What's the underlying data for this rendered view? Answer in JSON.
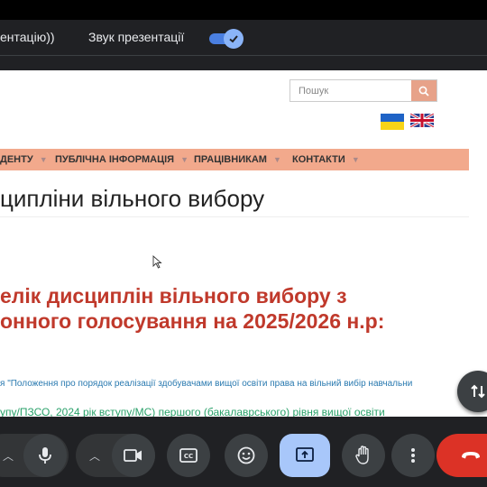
{
  "share_bar": {
    "tab_audio_text": "ентацію))",
    "sound_label": "Звук презентації",
    "sound_enabled": true
  },
  "website": {
    "search_placeholder": "Пошук",
    "languages": [
      "ua-flag-icon",
      "uk-flag-icon"
    ],
    "nav": [
      {
        "label": "ДЕНТУ"
      },
      {
        "label": "ПУБЛІЧНА ІНФОРМАЦІЯ"
      },
      {
        "label": "ПРАЦІВНИКАМ"
      },
      {
        "label": "КОНТАКТИ"
      }
    ],
    "page_heading": "ципліни вільного вибору",
    "main_heading_line1": "елік дисциплін вільного вибору з",
    "main_heading_line2": "онного голосування на 2025/2026 н.р:",
    "link1": "я \"Положення про порядок реалізації здобувачами вищої освіти права на вільний вибір навчальни",
    "link2": "упу/ПЗСО, 2024 рік вступу/МС) першого (бакалаврського) рівня вищої освіти"
  },
  "colors": {
    "accent_red": "#c0392b",
    "nav_bg": "#f2a98c",
    "toggle_blue": "#8ab4f8",
    "present_blue": "#a8c7fa",
    "hangup_red": "#dc3226"
  },
  "controls": {
    "icons": [
      "chevron-up-icon",
      "microphone-icon",
      "chevron-up-icon",
      "camera-icon",
      "captions-icon",
      "emoji-icon",
      "present-screen-icon",
      "raise-hand-icon",
      "more-options-icon",
      "hang-up-icon"
    ]
  }
}
